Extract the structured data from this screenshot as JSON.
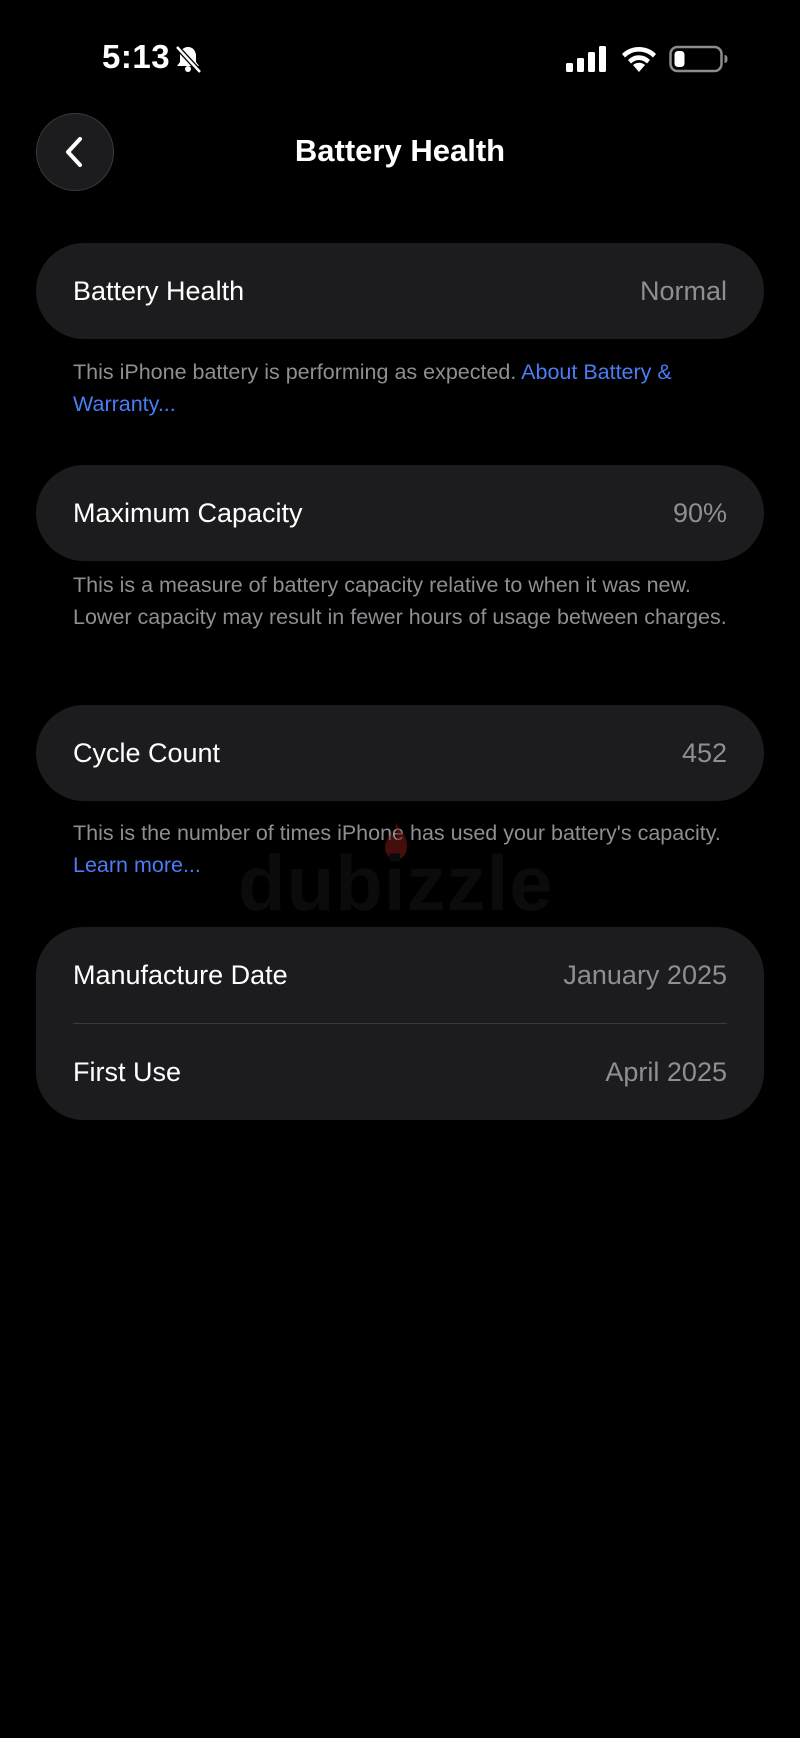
{
  "status_bar": {
    "time": "5:13",
    "icons": [
      "bell-slash-icon",
      "cellular-signal-icon",
      "wifi-icon",
      "battery-icon"
    ],
    "battery_level": 0.2
  },
  "nav": {
    "back_icon": "chevron-left-icon",
    "title": "Battery Health"
  },
  "sections": {
    "battery_health": {
      "label": "Battery Health",
      "value": "Normal",
      "footnote_text": "This iPhone battery is performing as expected. ",
      "footnote_link": "About Battery & Warranty..."
    },
    "maximum_capacity": {
      "label": "Maximum Capacity",
      "value": "90%",
      "footnote_text": "This is a measure of battery capacity relative to when it was new. Lower capacity may result in fewer hours of usage between charges."
    },
    "cycle_count": {
      "label": "Cycle Count",
      "value": "452",
      "footnote_text": "This is the number of times iPhone has used your battery's capacity. ",
      "footnote_link": "Learn more..."
    },
    "dates": {
      "manufacture_label": "Manufacture Date",
      "manufacture_value": "January 2025",
      "first_use_label": "First Use",
      "first_use_value": "April 2025"
    }
  },
  "watermark": {
    "text": "dubizzle"
  },
  "colors": {
    "background": "#000000",
    "card": "#1c1c1e",
    "secondary_text": "#8e8e93",
    "link": "#4a7cf5"
  }
}
